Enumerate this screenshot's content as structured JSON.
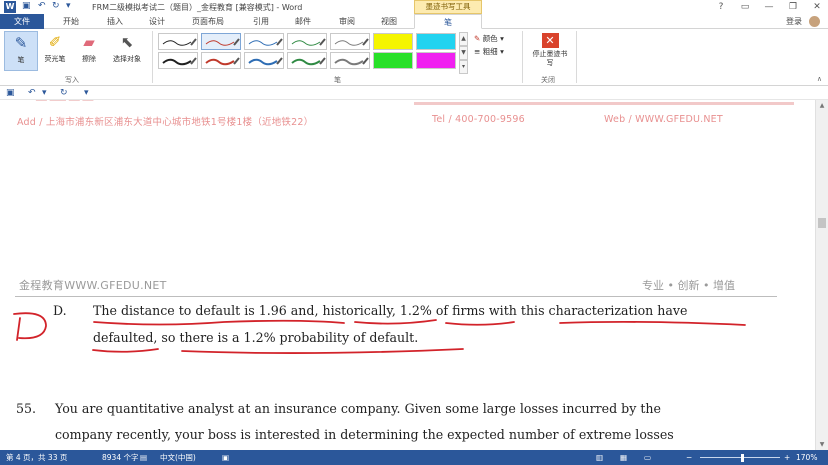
{
  "window": {
    "title": "FRM二级模拟考试二（题目）_金程教育 [兼容模式] - Word",
    "context_tab_group": "墨迹书写工具",
    "controls": [
      "?",
      "▭",
      "—",
      "❐",
      "✕"
    ],
    "login": "登录"
  },
  "tabs": [
    "文件",
    "开始",
    "插入",
    "设计",
    "页面布局",
    "引用",
    "邮件",
    "审阅",
    "视图",
    "笔"
  ],
  "ribbon": {
    "write_group": {
      "label": "写入",
      "buttons": [
        {
          "label": "笔",
          "icon": "pen-icon",
          "selected": true
        },
        {
          "label": "荧光笔",
          "icon": "highlighter-icon"
        },
        {
          "label": "擦除",
          "icon": "eraser-icon"
        },
        {
          "label": "选择对象",
          "icon": "select-cursor-icon"
        }
      ]
    },
    "pens_group": {
      "label": "笔",
      "pen_colors": [
        "#1f1f1f",
        "#c0392b",
        "#2e6db4",
        "#2f8a43",
        "#7a7a7a",
        "#1f1f1f",
        "#c0392b",
        "#2e6db4",
        "#2f8a43",
        "#7a7a7a"
      ],
      "highlighter_colors": [
        "#f5f500",
        "#22d3f0",
        "#28e028",
        "#f020f0"
      ],
      "color_option": "颜色",
      "weight_option": "粗细"
    },
    "close_group": {
      "label": "关闭",
      "stop_button": "停止墨迹书写"
    }
  },
  "document": {
    "header_address": "Add / 上海市浦东新区浦东大道中心城市地铁1号楼1楼（近地铁22）",
    "header_tel": "Tel / 400-700-9596",
    "header_web": "Web / WWW.GFEDU.NET",
    "brand": "金程教育WWW.GFEDU.NET",
    "tagline": "专业 • 创新 • 增值",
    "option_d_letter": "D.",
    "option_d_line1": "The distance to default is 1.96 and, historically, 1.2% of firms with this characterization have",
    "option_d_line2": "defaulted, so there is a 1.2% probability of default.",
    "question_number": "55.",
    "question_line1": "You are quantitative analyst at an insurance company. Given some large losses incurred by the",
    "question_line2": "company recently, your boss is interested in determining the expected number of extreme losses",
    "ink_color": "#d2232a"
  },
  "status_bar": {
    "page": "第 4 页，共 33 页",
    "words": "8934 个字",
    "language": "中文(中国)",
    "zoom": "170%"
  }
}
